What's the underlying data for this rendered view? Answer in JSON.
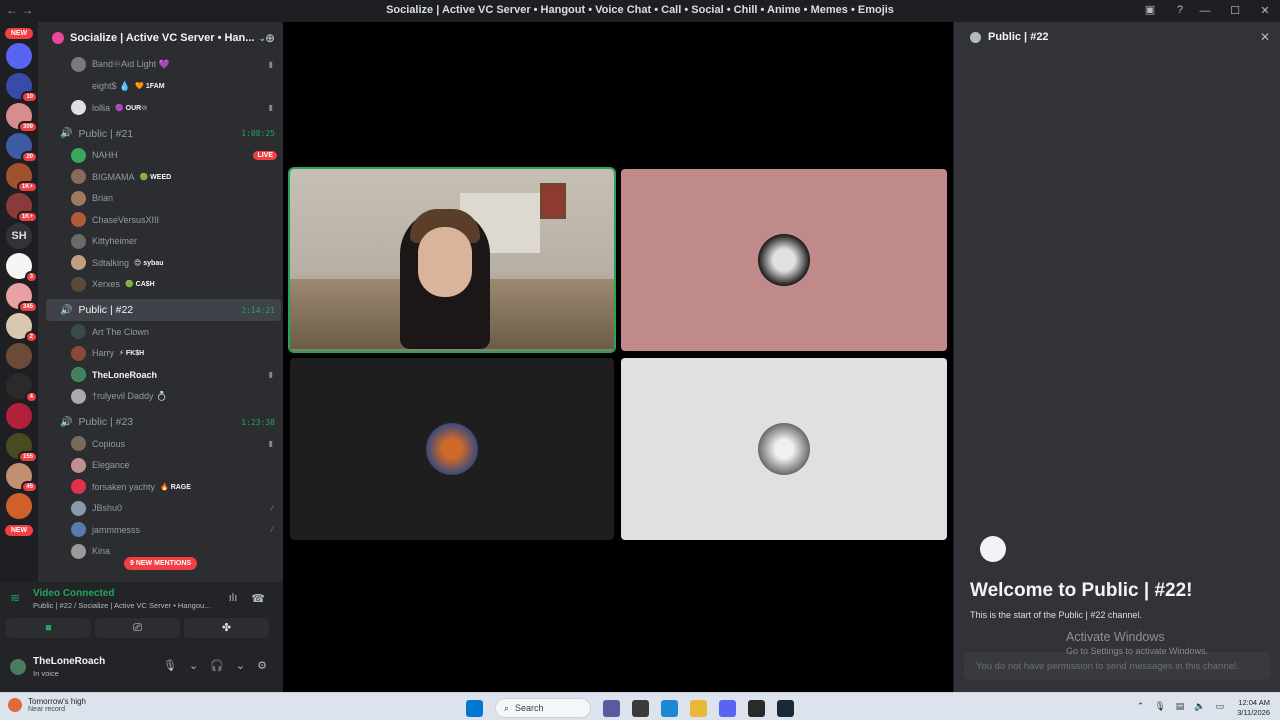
{
  "window": {
    "title": "Socialize | Active VC Server • Hangout • Voice Chat • Call • Social • Chill • Anime • Memes • Emojis",
    "back": "←",
    "forward": "→",
    "controls": [
      "—",
      "☐",
      "✕"
    ]
  },
  "servers": {
    "new_top": "NEW",
    "new_bottom": "NEW",
    "sh_label": "SH",
    "badges": [
      "10",
      "309",
      "20",
      "1K+",
      "1K+",
      "3",
      "345",
      "2",
      "4",
      "155",
      "45"
    ]
  },
  "guild": {
    "name": "Socialize | Active VC Server • Han...",
    "invite_icon": "add-member-icon"
  },
  "channels": {
    "top_members": [
      {
        "name": "Band♾Aid Light 💜",
        "tag": "",
        "icon": "▮"
      },
      {
        "name": "eight$ 💧",
        "tag": "🧡 1FAM",
        "icon": ""
      },
      {
        "name": "lollia",
        "tag": "🟣 OUR♾",
        "icon": "▮"
      }
    ],
    "ch21": {
      "name": "Public | #21",
      "timer": "1:08:25",
      "members": [
        {
          "name": "NAHH",
          "tag": "",
          "live": "LIVE"
        },
        {
          "name": "BIGMAMA",
          "tag": "🟢 WEED"
        },
        {
          "name": "Brian",
          "tag": ""
        },
        {
          "name": "ChaseVersusXIII",
          "tag": ""
        },
        {
          "name": "Kittyheimer",
          "tag": ""
        },
        {
          "name": "Sdtalking",
          "tag": "😊 sybau"
        },
        {
          "name": "Xerxes",
          "tag": "🟢 CA$H"
        }
      ]
    },
    "ch22": {
      "name": "Public | #22",
      "timer": "2:14:21",
      "members": [
        {
          "name": "Art The Clown",
          "tag": ""
        },
        {
          "name": "Harry",
          "tag": "⚡ FK$H"
        },
        {
          "name": "TheLoneRoach",
          "tag": ""
        },
        {
          "name": "†rulyevil Daddy 💍",
          "tag": ""
        }
      ]
    },
    "ch23": {
      "name": "Public | #23",
      "timer": "1:23:38",
      "members": [
        {
          "name": "Copious",
          "tag": ""
        },
        {
          "name": "Elegance",
          "tag": ""
        },
        {
          "name": "forsaken yachty",
          "tag": "🔥 RAGE"
        },
        {
          "name": "JBshu0",
          "tag": ""
        },
        {
          "name": "jammmesss",
          "tag": ""
        },
        {
          "name": "Kina",
          "tag": ""
        }
      ]
    },
    "mentions": "9 NEW MENTIONS"
  },
  "voice": {
    "status": "Video Connected",
    "location": "Public | #22 / Socialize | Active VC Server • Hangou..."
  },
  "user": {
    "name": "TheLoneRoach",
    "status": "In voice"
  },
  "sidepanel": {
    "channel": "Public | #22",
    "welcome": "Welcome to Public | #22!",
    "start": "This is the start of the Public | #22 channel.",
    "input_placeholder": "You do not have permission to send messages in this channel."
  },
  "watermark": {
    "title": "Activate Windows",
    "sub": "Go to Settings to activate Windows."
  },
  "taskbar": {
    "weather_line1": "Tomorrow's high",
    "weather_line2": "Near record",
    "search": "Search",
    "time": "12:04 AM",
    "date": "3/11/2026"
  },
  "colors": {
    "accent_green": "#23a55a",
    "danger_red": "#f23f43",
    "tile_pink": "#c08a8a",
    "tile_dark": "#1e1e1e",
    "tile_light": "#e0e0e2"
  }
}
